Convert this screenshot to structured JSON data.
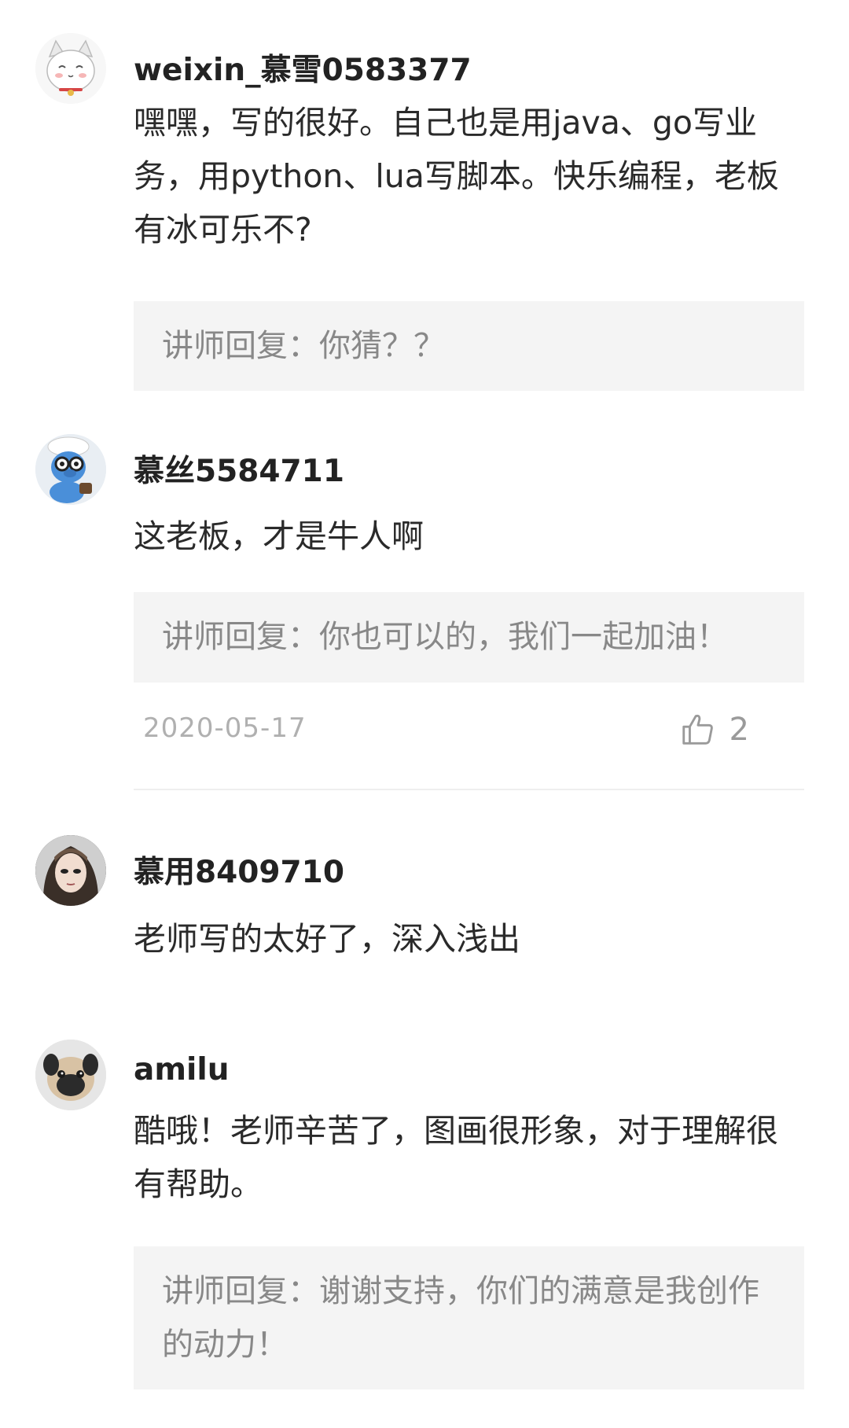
{
  "comments": [
    {
      "username": "weixin_慕雪0583377",
      "avatar": "cat-avatar",
      "content": "嘿嘿，写的很好。自己也是用java、go写业务，用python、lua写脚本。快乐编程，老板有冰可乐不?",
      "reply_prefix": "讲师回复：",
      "reply_text": "你猜？？"
    },
    {
      "username": "慕丝5584711",
      "avatar": "blue-creature-avatar",
      "content": "这老板，才是牛人啊",
      "reply_prefix": "讲师回复：",
      "reply_text": "你也可以的，我们一起加油！",
      "date": "2020-05-17",
      "like_count": "2"
    },
    {
      "username": "慕用8409710",
      "avatar": "portrait-avatar",
      "content": "老师写的太好了，深入浅出"
    },
    {
      "username": "amilu",
      "avatar": "pug-avatar",
      "content": "酷哦！老师辛苦了，图画很形象，对于理解很有帮助。",
      "reply_prefix": "讲师回复：",
      "reply_text": "谢谢支持，你们的满意是我创作的动力！"
    }
  ],
  "icons": {
    "like": "thumbs-up-icon"
  },
  "colors": {
    "reply_bg": "#f4f4f4",
    "muted_text": "#888888",
    "date_text": "#b0b0b0"
  }
}
